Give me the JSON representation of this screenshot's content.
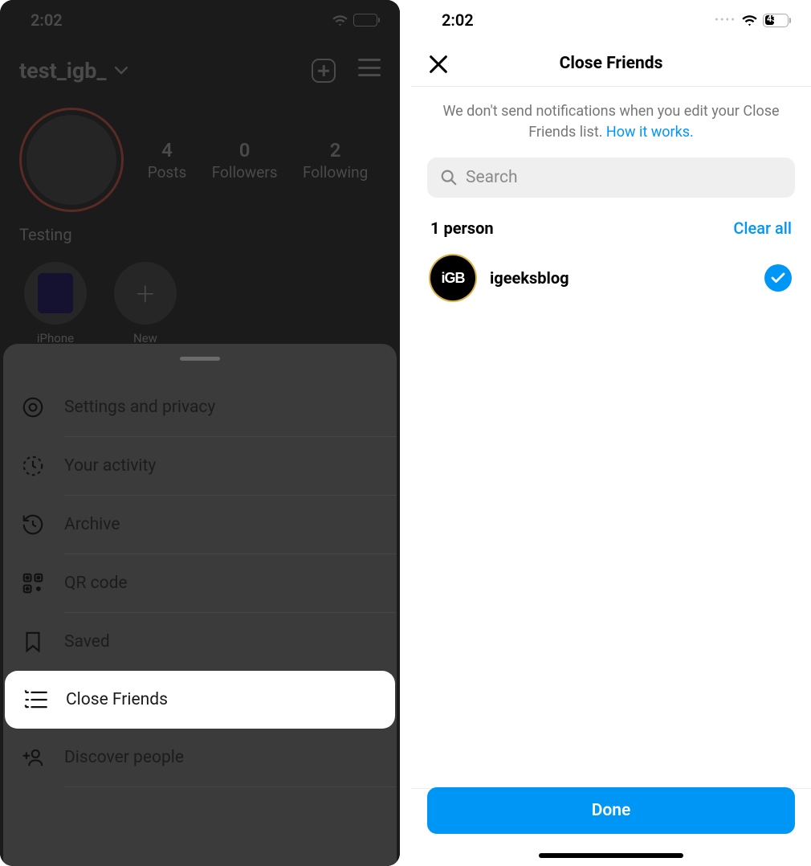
{
  "status": {
    "time": "2:02",
    "battery_pct": 43
  },
  "left": {
    "username": "test_igb_",
    "display_name": "Testing",
    "stats": {
      "posts_count": "4",
      "posts_label": "Posts",
      "followers_count": "0",
      "followers_label": "Followers",
      "following_count": "2",
      "following_label": "Following"
    },
    "highlights": [
      {
        "label": "iPhone"
      },
      {
        "label": "New"
      }
    ],
    "menu": {
      "items": [
        {
          "label": "Settings and privacy",
          "icon": "gear"
        },
        {
          "label": "Your activity",
          "icon": "activity"
        },
        {
          "label": "Archive",
          "icon": "archive"
        },
        {
          "label": "QR code",
          "icon": "qrcode"
        },
        {
          "label": "Saved",
          "icon": "bookmark"
        },
        {
          "label": "Close Friends",
          "icon": "close-friends",
          "active": true
        },
        {
          "label": "Discover people",
          "icon": "discover"
        }
      ]
    }
  },
  "right": {
    "title": "Close Friends",
    "info_text": "We don't send notifications when you edit your Close Friends list. ",
    "info_link": "How it works.",
    "search_placeholder": "Search",
    "count_label": "1 person",
    "clear_all": "Clear all",
    "friends": [
      {
        "username": "igeeksblog",
        "avatar_text": "iGB",
        "selected": true
      }
    ],
    "done_label": "Done"
  }
}
